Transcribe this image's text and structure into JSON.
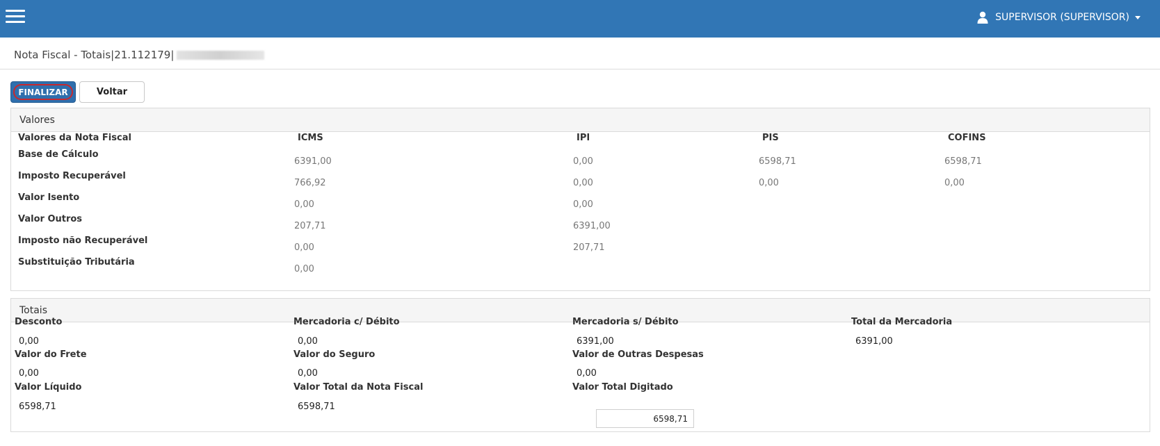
{
  "header": {
    "user_label": "SUPERVISOR (SUPERVISOR)"
  },
  "page": {
    "title": "Nota Fiscal - Totais|21.112179|"
  },
  "actions": {
    "finalizar": "FINALIZAR",
    "voltar": "Voltar"
  },
  "valores": {
    "section_title": "Valores",
    "row_header": "Valores da Nota Fiscal",
    "columns": [
      "ICMS",
      "IPI",
      "PIS",
      "COFINS"
    ],
    "rows": [
      {
        "label": "Base de Cálculo",
        "icms": "6391,00",
        "ipi": "0,00",
        "pis": "6598,71",
        "cofins": "6598,71"
      },
      {
        "label": "Imposto Recuperável",
        "icms": "766,92",
        "ipi": "0,00",
        "pis": "0,00",
        "cofins": "0,00"
      },
      {
        "label": "Valor Isento",
        "icms": "0,00",
        "ipi": "0,00"
      },
      {
        "label": "Valor Outros",
        "icms": "207,71",
        "ipi": "6391,00"
      },
      {
        "label": "Imposto não Recuperável",
        "icms": "0,00",
        "ipi": "207,71"
      },
      {
        "label": "Substituição Tributária",
        "icms": "0,00"
      }
    ]
  },
  "totais": {
    "section_title": "Totais",
    "desconto": {
      "label": "Desconto",
      "value": "0,00"
    },
    "merc_debito": {
      "label": "Mercadoria c/ Débito",
      "value": "0,00"
    },
    "merc_sem_debito": {
      "label": "Mercadoria s/ Débito",
      "value": "6391,00"
    },
    "total_mercadoria": {
      "label": "Total da Mercadoria",
      "value": "6391,00"
    },
    "frete": {
      "label": "Valor do Frete",
      "value": "0,00"
    },
    "seguro": {
      "label": "Valor do Seguro",
      "value": "0,00"
    },
    "outras_despesas": {
      "label": "Valor de Outras Despesas",
      "value": "0,00"
    },
    "liquido": {
      "label": "Valor Líquido",
      "value": "6598,71"
    },
    "total_nf": {
      "label": "Valor Total da Nota Fiscal",
      "value": "6598,71"
    },
    "total_digitado": {
      "label": "Valor Total Digitado",
      "value": "6598,71"
    }
  }
}
